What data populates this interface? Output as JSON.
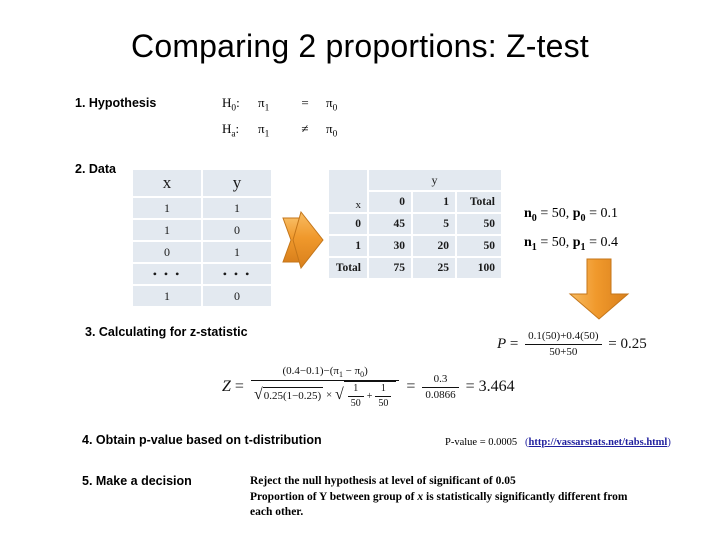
{
  "slide": {
    "title": "Comparing 2 proportions: Z-test"
  },
  "steps": {
    "step1": "1. Hypothesis",
    "step2": "2. Data",
    "step3": "3. Calculating for z-statistic",
    "step4": "4. Obtain p-value based on t-distribution",
    "step5": "5. Make a decision"
  },
  "hypothesis": {
    "null": {
      "name": "H",
      "sub": "0",
      "colon": ":",
      "lhs": "π",
      "lhs_sub": "1",
      "operator": "=",
      "rhs": "π",
      "rhs_sub": "0"
    },
    "alt": {
      "name": "H",
      "sub": "a",
      "colon": ":",
      "lhs": "π",
      "lhs_sub": "1",
      "operator": "≠",
      "rhs": "π",
      "rhs_sub": "0"
    }
  },
  "data_table": {
    "headers": [
      "x",
      "y"
    ],
    "rows": [
      [
        "1",
        "1"
      ],
      [
        "1",
        "0"
      ],
      [
        "0",
        "1"
      ],
      [
        "• • •",
        "• • •"
      ],
      [
        "1",
        "0"
      ]
    ]
  },
  "contingency_table": {
    "row_var": "x",
    "col_var": "y",
    "col_headers": [
      "0",
      "1",
      "Total"
    ],
    "row_headers": [
      "0",
      "1",
      "Total"
    ],
    "cells": [
      [
        "45",
        "5",
        "50"
      ],
      [
        "30",
        "20",
        "50"
      ],
      [
        "75",
        "25",
        "100"
      ]
    ]
  },
  "group_stats": {
    "line1": {
      "n_label": "n",
      "n_sub": "0",
      "n_value": "50",
      "p_label": "p",
      "p_sub": "0",
      "p_value": "0.1"
    },
    "line2": {
      "n_label": "n",
      "n_sub": "1",
      "n_value": "50",
      "p_label": "p",
      "p_sub": "1",
      "p_value": "0.4"
    }
  },
  "formulas": {
    "p_pooled": {
      "lhs": "P",
      "equals": "=",
      "numerator": "0.1(50)+0.4(50)",
      "denominator": "50+50",
      "equals2": "=",
      "result": "0.25"
    },
    "z_statistic": {
      "lhs": "Z",
      "equals": "=",
      "numerator": "(0.4−0.1)−(π₁ − π₀)",
      "num_part1": "(0.4−0.1)−(",
      "num_pi1": "π",
      "num_pi1_sub": "1",
      "num_minus": "−",
      "num_pi0": "π",
      "num_pi0_sub": "0",
      "num_close": ")",
      "den_sqrt1": "0.25(1−0.25)",
      "den_times": "×",
      "den_sqrt2_num1": "1",
      "den_sqrt2_den1": "50",
      "den_sqrt2_plus": "+",
      "den_sqrt2_num2": "1",
      "den_sqrt2_den2": "50",
      "equals2": "=",
      "ratio_num": "0.3",
      "ratio_den": "0.0866",
      "equals3": "=",
      "result": "3.464"
    }
  },
  "pvalue": {
    "text": "P-value = 0.0005",
    "link_open": "(",
    "link": "http://vassarstats.net/tabs.html",
    "link_close": ")"
  },
  "decision": {
    "line1": "Reject the null hypothesis  at level of significant of 0.05",
    "line2a": "Proportion of Y between group of ",
    "line2b": "x",
    "line2c": " is statistically significantly different from",
    "line3": "each other."
  },
  "icons": {
    "arrow_right": "arrow-right-icon",
    "arrow_down": "arrow-down-icon"
  },
  "colors": {
    "arrow_orange_light": "#F4A93E",
    "arrow_orange_dark": "#D9801C",
    "table_cell": "#E3E9F0",
    "link_blue": "#201F9E"
  }
}
